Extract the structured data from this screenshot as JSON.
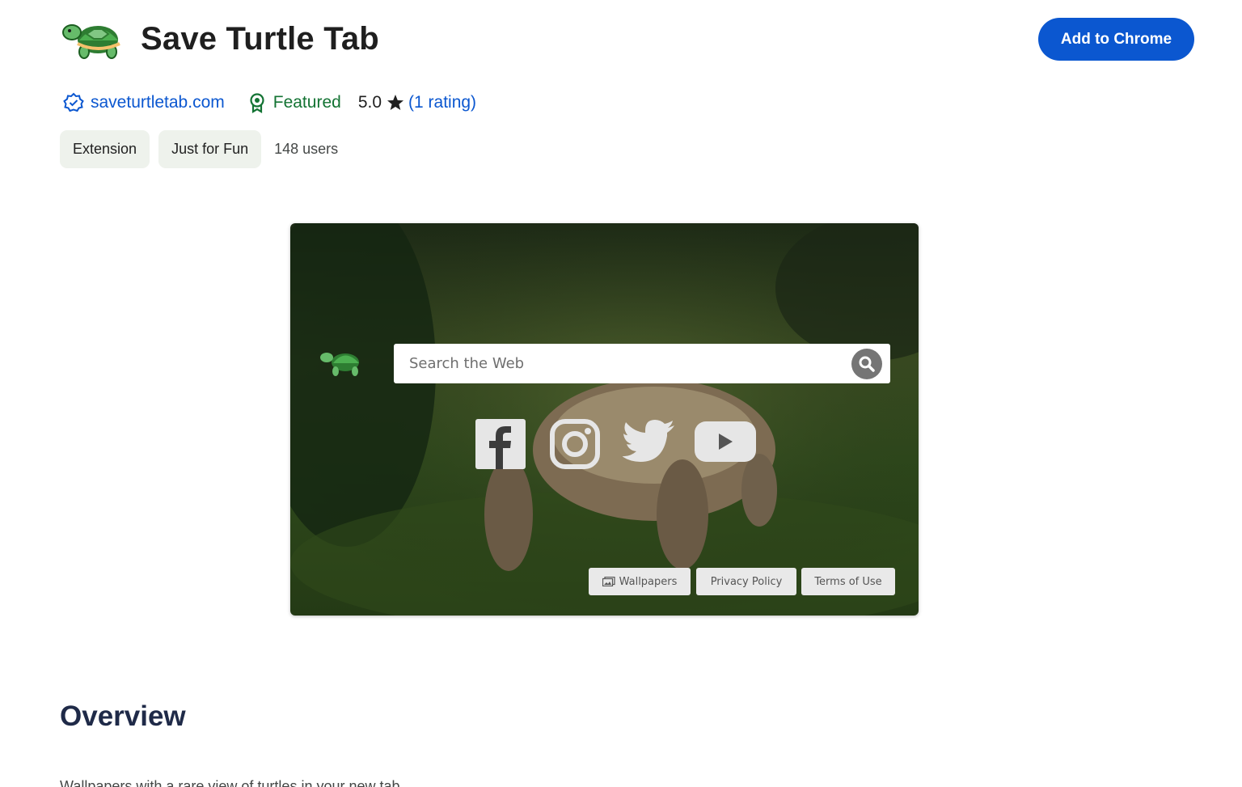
{
  "header": {
    "title": "Save Turtle Tab",
    "add_button": "Add to Chrome",
    "logo_icon": "turtle-icon"
  },
  "meta": {
    "site": "saveturtletab.com",
    "featured": "Featured",
    "rating_value": "5.0",
    "rating_count": "(1 rating)"
  },
  "chips": [
    "Extension",
    "Just for Fun"
  ],
  "users": "148 users",
  "preview": {
    "search_placeholder": "Search the Web",
    "social_icons": [
      "facebook-icon",
      "instagram-icon",
      "twitter-icon",
      "youtube-icon"
    ],
    "footer_buttons": [
      "Wallpapers",
      "Privacy Policy",
      "Terms of Use"
    ]
  },
  "overview": {
    "heading": "Overview",
    "description": "Wallpapers with a rare view of turtles in your new tab"
  },
  "colors": {
    "accent": "#0b57d0",
    "featured": "#137333",
    "chip_bg": "#eef2ec",
    "heading": "#1f2a48"
  }
}
